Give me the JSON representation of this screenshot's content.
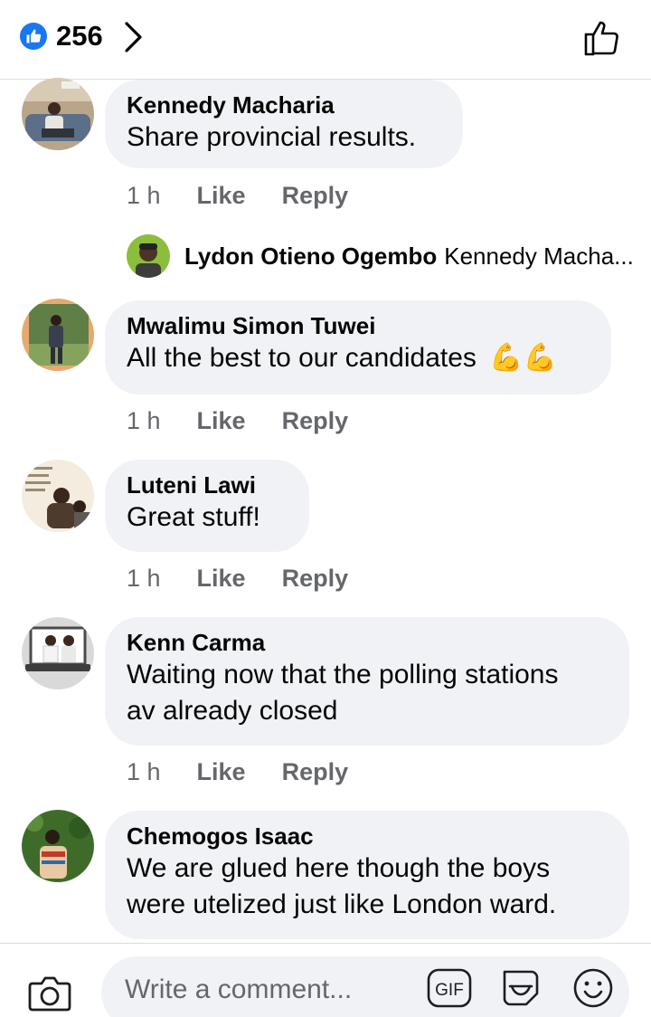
{
  "header": {
    "like_count": "256",
    "icons": [
      "like-badge-icon",
      "chevron-right-icon",
      "thumbs-up-outline-icon"
    ],
    "accent_color": "#1877f2"
  },
  "comments": [
    {
      "name": "Kennedy Macharia",
      "text": "Share provincial results.",
      "time": "1 h",
      "like": "Like",
      "reply": "Reply"
    },
    {
      "name": "Mwalimu Simon Tuwei",
      "text": "All the best to our candidates",
      "emoji": "💪💪",
      "time": "1 h",
      "like": "Like",
      "reply": "Reply"
    },
    {
      "name": "Luteni Lawi",
      "text": "Great stuff!",
      "time": "1 h",
      "like": "Like",
      "reply": "Reply"
    },
    {
      "name": "Kenn Carma",
      "text_lines": [
        "Waiting now that the polling stations",
        "av already closed"
      ],
      "time": "1 h",
      "like": "Like",
      "reply": "Reply"
    },
    {
      "name": "Chemogos Isaac",
      "text_lines": [
        "We are glued here though the boys",
        "were utelized just like London ward."
      ]
    }
  ],
  "reply_preview": {
    "name": "Lydon Otieno Ogembo",
    "text": "Kennedy Macha..."
  },
  "composer": {
    "placeholder": "Write a comment...",
    "gif_label": "GIF",
    "icons": [
      "camera-icon",
      "gif-icon",
      "sticker-icon",
      "emoji-icon"
    ]
  }
}
